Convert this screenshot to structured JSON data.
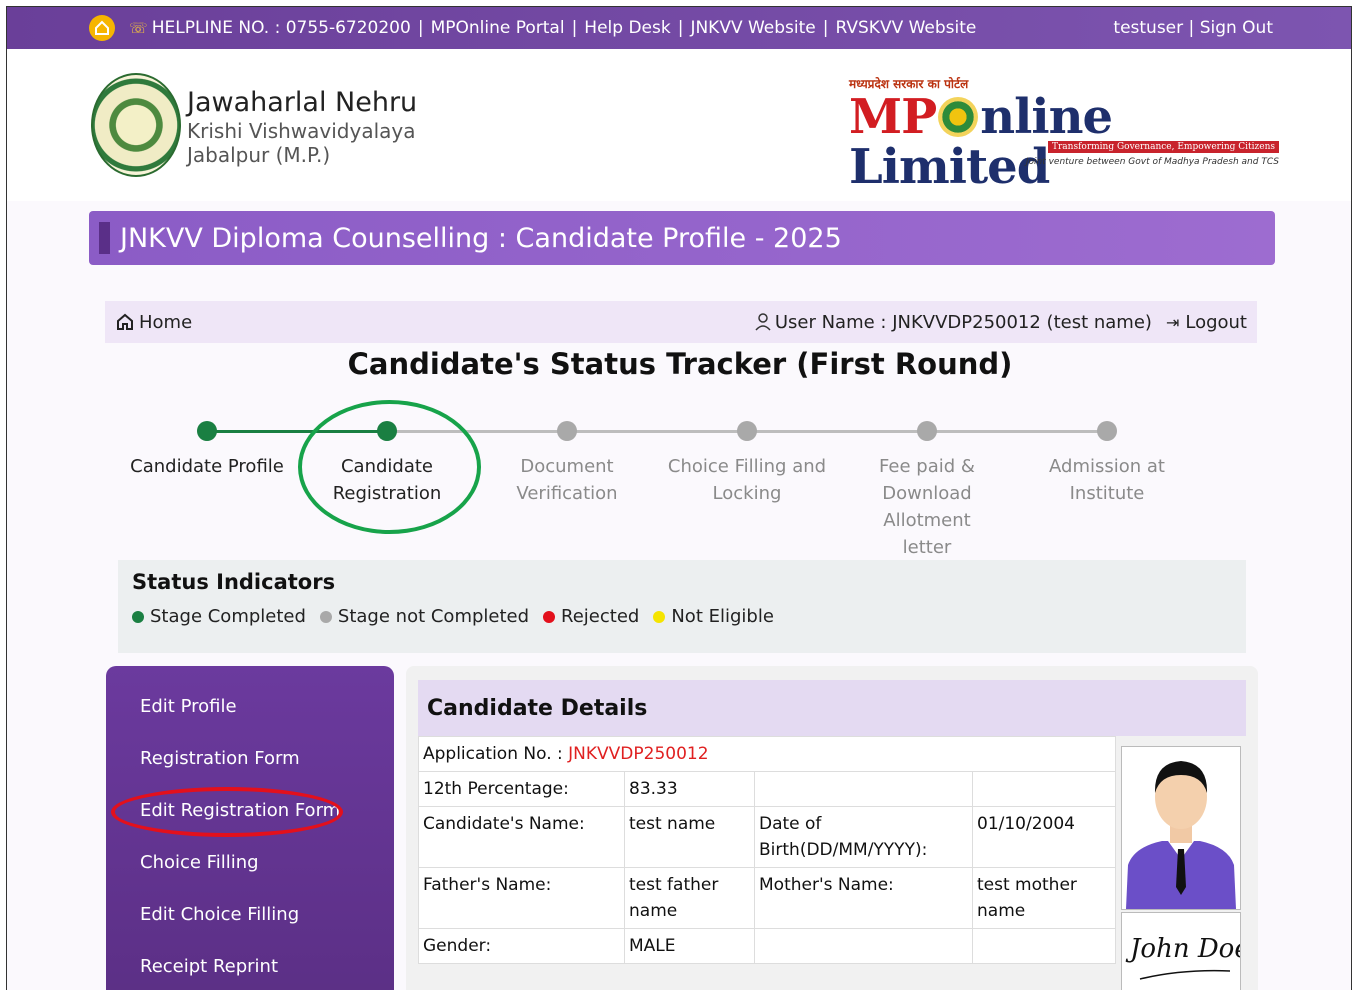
{
  "topbar": {
    "helpline": "HELPLINE NO. : 0755-6720200",
    "links": [
      "MPOnline Portal",
      "Help Desk",
      "JNKVV Website",
      "RVSKVV Website"
    ],
    "user": "testuser",
    "signout": "Sign Out"
  },
  "header": {
    "university_line1": "Jawaharlal Nehru",
    "university_line2": "Krishi Vishwavidyalaya",
    "university_line3": "Jabalpur (M.P.)",
    "mp_small": "मध्यप्रदेश सरकार का पोर्टल",
    "mp_name_a": "MP",
    "mp_name_b": "nline Limited",
    "mp_tagline": "Transforming Governance, Empowering Citizens",
    "mp_jv": "Joint venture between Govt of Madhya Pradesh and TCS"
  },
  "page_title": "JNKVV Diploma Counselling : Candidate Profile - 2025",
  "nav": {
    "home": "Home",
    "user_name": "User Name : JNKVVDP250012 (test name)",
    "logout": "Logout"
  },
  "tracker": {
    "title": "Candidate's Status Tracker (First Round)",
    "steps": [
      {
        "label": "Candidate Profile",
        "state": "done"
      },
      {
        "label": "Candidate Registration",
        "state": "done"
      },
      {
        "label": "Document Verification",
        "state": "pending"
      },
      {
        "label": "Choice Filling and Locking",
        "state": "pending"
      },
      {
        "label": "Fee paid & Download Allotment letter",
        "state": "pending"
      },
      {
        "label": "Admission at Institute",
        "state": "pending"
      }
    ]
  },
  "status": {
    "title": "Status Indicators",
    "items": [
      {
        "label": "Stage Completed",
        "color": "#1a7f42"
      },
      {
        "label": "Stage not Completed",
        "color": "#a9a9a9"
      },
      {
        "label": "Rejected",
        "color": "#e3101c"
      },
      {
        "label": "Not Eligible",
        "color": "#f5e400"
      }
    ]
  },
  "sidebar": {
    "items": [
      "Edit Profile",
      "Registration Form",
      "Edit Registration Form",
      "Choice Filling",
      "Edit Choice Filling",
      "Receipt Reprint"
    ]
  },
  "details": {
    "title": "Candidate Details",
    "app_label": "Application No. :",
    "app_no": "JNKVVDP250012",
    "pct_label": "12th Percentage:",
    "pct": "83.33",
    "name_label": "Candidate's Name:",
    "name": "test name",
    "dob_label": "Date of Birth(DD/MM/YYYY):",
    "dob": "01/10/2004",
    "father_label": "Father's Name:",
    "father": "test father name",
    "mother_label": "Mother's Name:",
    "mother": "test mother name",
    "gender_label": "Gender:",
    "gender": "MALE",
    "signature_text": "John Doe"
  }
}
